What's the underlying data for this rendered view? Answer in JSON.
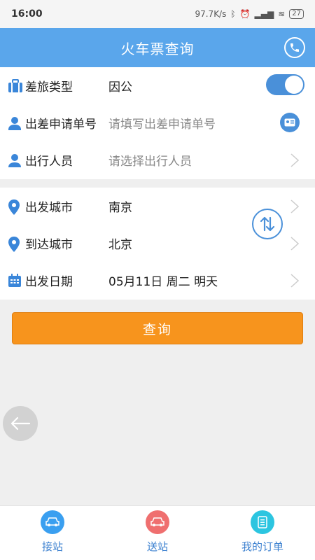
{
  "status_bar": {
    "time": "16:00",
    "speed": "97.7K/s",
    "battery": "27"
  },
  "header": {
    "title": "火车票查询",
    "phone_icon": "phone-icon"
  },
  "form": {
    "travel_type": {
      "label": "差旅类型",
      "value": "因公",
      "toggle_on": true
    },
    "application_no": {
      "label": "出差申请单号",
      "placeholder": "请填写出差申请单号"
    },
    "traveler": {
      "label": "出行人员",
      "placeholder": "请选择出行人员"
    },
    "from_city": {
      "label": "出发城市",
      "value": "南京"
    },
    "to_city": {
      "label": "到达城市",
      "value": "北京"
    },
    "depart_date": {
      "label": "出发日期",
      "value": "05月11日 周二 明天"
    }
  },
  "query_button": {
    "label": "查询"
  },
  "bottom_nav": {
    "items": [
      {
        "label": "接站",
        "color": "#3a9ff0",
        "icon": "car-icon"
      },
      {
        "label": "送站",
        "color": "#ef6f6f",
        "icon": "car-icon"
      },
      {
        "label": "我的订单",
        "color": "#2cc5e0",
        "icon": "order-icon"
      }
    ]
  },
  "colors": {
    "header": "#5aa6eb",
    "accent": "#4a90d9",
    "button": "#f7941d"
  }
}
